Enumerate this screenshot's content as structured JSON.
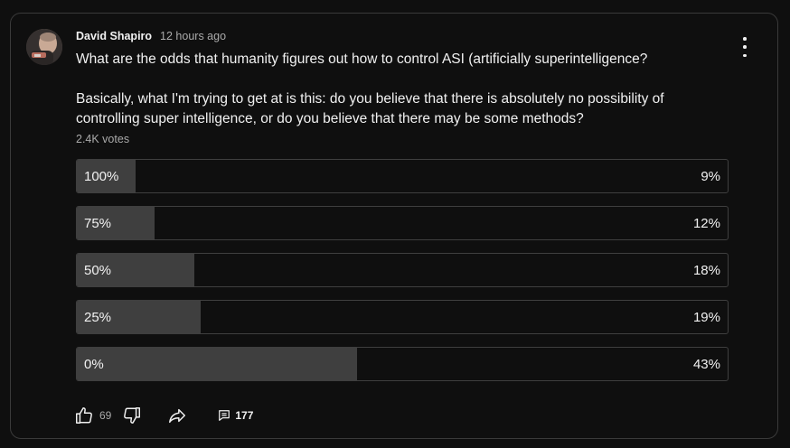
{
  "post": {
    "author": "David Shapiro",
    "time": "12 hours ago",
    "question": "What are the odds that humanity figures out how to control ASI (artificially superintelligence?\n\nBasically, what I'm trying to get at is this: do you believe that there is absolutely no possibility of controlling super intelligence, or do you believe that there may be some methods?",
    "votes": "2.4K votes"
  },
  "poll": {
    "options": [
      {
        "label": "100%",
        "percent": "9%",
        "fraction": 0.09
      },
      {
        "label": "75%",
        "percent": "12%",
        "fraction": 0.12
      },
      {
        "label": "50%",
        "percent": "18%",
        "fraction": 0.18
      },
      {
        "label": "25%",
        "percent": "19%",
        "fraction": 0.19
      },
      {
        "label": "0%",
        "percent": "43%",
        "fraction": 0.43
      }
    ]
  },
  "actions": {
    "like_count": "69",
    "comment_count": "177"
  },
  "icons": {
    "like": "thumbs-up-icon",
    "dislike": "thumbs-down-icon",
    "share": "share-icon",
    "comment": "comment-icon",
    "menu": "more-vert-icon"
  },
  "colors": {
    "background": "#0f0f0f",
    "border": "#3a3a3a",
    "bar_fill": "#3f3f3f",
    "text": "#f1f1f1",
    "muted": "#aaaaaa"
  }
}
